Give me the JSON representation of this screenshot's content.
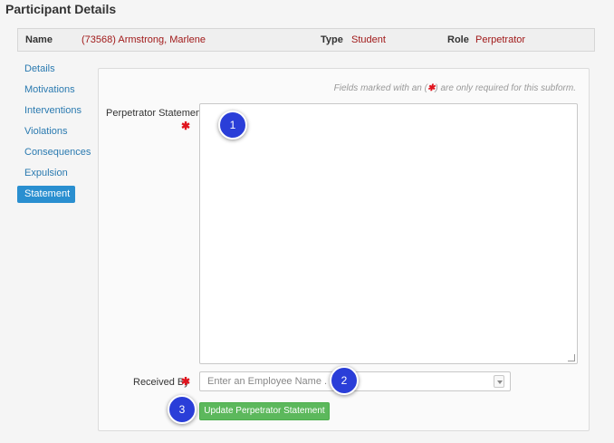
{
  "page": {
    "title": "Participant Details"
  },
  "participant": {
    "name_label": "Name",
    "name_value": "(73568) Armstrong, Marlene",
    "type_label": "Type",
    "type_value": "Student",
    "role_label": "Role",
    "role_value": "Perpetrator"
  },
  "sidebar": {
    "items": [
      {
        "label": "Details"
      },
      {
        "label": "Motivations"
      },
      {
        "label": "Interventions"
      },
      {
        "label": "Violations"
      },
      {
        "label": "Consequences"
      },
      {
        "label": "Expulsion"
      },
      {
        "label": "Statement",
        "active": true
      }
    ]
  },
  "form": {
    "required_note_prefix": "Fields marked with an (",
    "required_note_star": "✱",
    "required_note_suffix": ") are only required for this subform.",
    "statement_label": "Perpetrator Statement",
    "required_star": "✱",
    "statement_value": "",
    "received_by_label": "Received By",
    "received_by_placeholder": "Enter an Employee Name . . .",
    "submit_label": "Update Perpetrator Statement"
  },
  "callouts": [
    "1",
    "2",
    "3"
  ],
  "colors": {
    "accent": "#2a8fd0",
    "link": "#2a7ab0",
    "value_red": "#a11a1a",
    "required_star": "#e0141e",
    "button_green": "#5cb85c",
    "callout_blue": "#2a3ed8"
  }
}
